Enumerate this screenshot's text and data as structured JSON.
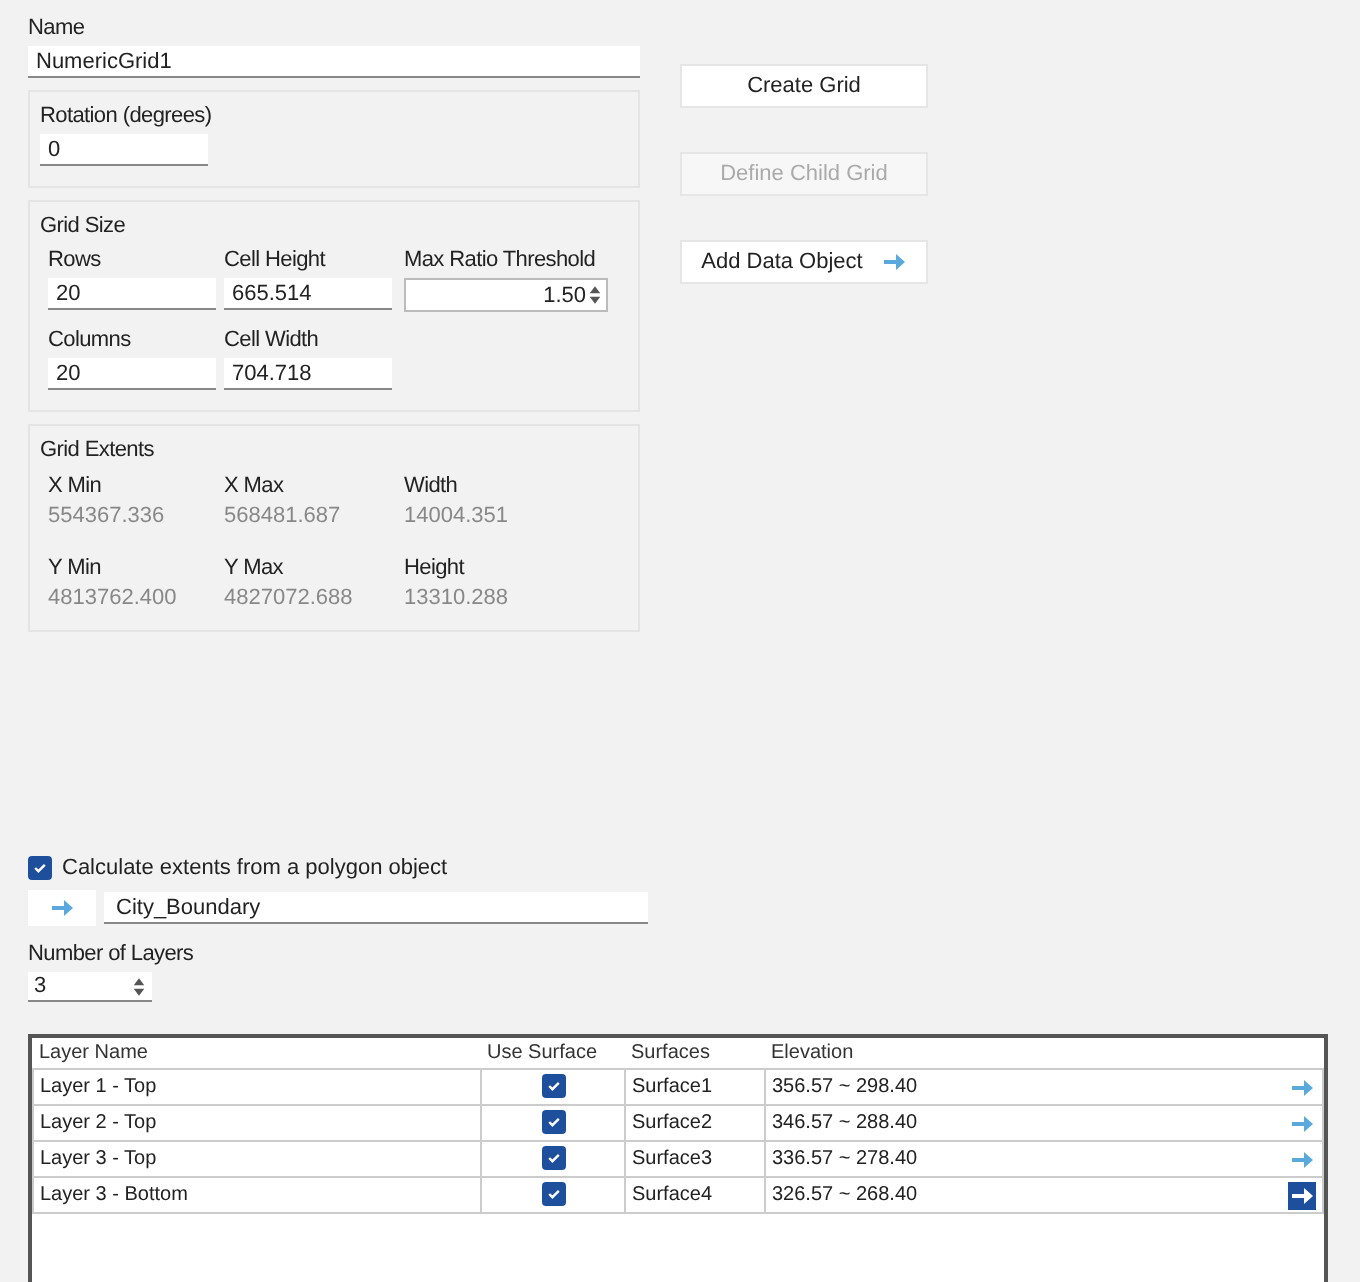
{
  "name": {
    "label": "Name",
    "value": "NumericGrid1"
  },
  "rotation": {
    "label": "Rotation (degrees)",
    "value": "0"
  },
  "grid_size": {
    "title": "Grid Size",
    "fields": [
      {
        "label": "Rows",
        "value": "20",
        "kind": "text"
      },
      {
        "label": "Cell Height",
        "value": "665.514",
        "kind": "text"
      },
      {
        "label": "Max Ratio Threshold",
        "value": "1.50",
        "kind": "spin"
      },
      {
        "label": "Columns",
        "value": "20",
        "kind": "text"
      },
      {
        "label": "Cell Width",
        "value": "704.718",
        "kind": "text"
      }
    ]
  },
  "grid_extents": {
    "title": "Grid Extents",
    "items": [
      {
        "label": "X Min",
        "value": "554367.336"
      },
      {
        "label": "X Max",
        "value": "568481.687"
      },
      {
        "label": "Width",
        "value": "14004.351"
      },
      {
        "label": "Y Min",
        "value": "4813762.400"
      },
      {
        "label": "Y Max",
        "value": "4827072.688"
      },
      {
        "label": "Height",
        "value": "13310.288"
      }
    ]
  },
  "buttons": [
    {
      "label": "Create Grid",
      "disabled": false,
      "kind": "plain"
    },
    {
      "label": "Define Child Grid",
      "disabled": true,
      "kind": "plain"
    },
    {
      "label": "Add Data Object",
      "disabled": false,
      "kind": "arrow"
    }
  ],
  "polygon": {
    "label": "Calculate extents from a polygon object",
    "checked": true,
    "value": "City_Boundary"
  },
  "layers": {
    "label": "Number of Layers",
    "value": "3"
  },
  "table": {
    "columns": [
      "Layer Name",
      "Use Surface",
      "Surfaces",
      "Elevation"
    ],
    "rows": [
      {
        "name": "Layer 1 - Top",
        "use_surface": true,
        "surface": "Surface1",
        "elevation": "356.57 ~ 298.40",
        "selected": false
      },
      {
        "name": "Layer 2 - Top",
        "use_surface": true,
        "surface": "Surface2",
        "elevation": "346.57 ~ 288.40",
        "selected": false
      },
      {
        "name": "Layer 3 - Top",
        "use_surface": true,
        "surface": "Surface3",
        "elevation": "336.57 ~ 278.40",
        "selected": false
      },
      {
        "name": "Layer 3 - Bottom",
        "use_surface": true,
        "surface": "Surface4",
        "elevation": "326.57 ~ 268.40",
        "selected": true
      }
    ]
  }
}
